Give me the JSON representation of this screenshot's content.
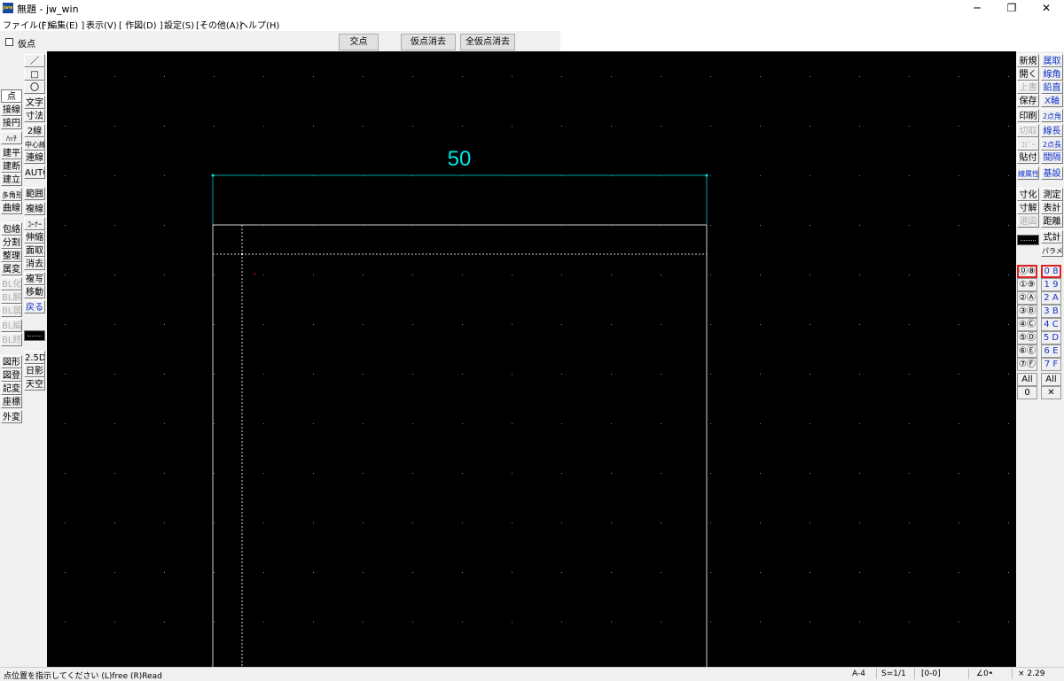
{
  "window": {
    "title": "無題 - jw_win",
    "icon_text": "Jww",
    "minimize": "─",
    "restore": "❐",
    "close": "✕"
  },
  "menu": [
    "ファイル(F)",
    "[ 編集(E) ]",
    "表示(V)",
    "[ 作図(D) ]",
    "設定(S)",
    "[その他(A)]",
    "ヘルプ(H)"
  ],
  "toolbar": {
    "kari_label": "仮点",
    "kouten": "交点",
    "karisyoukyo": "仮点消去",
    "zenkari": "全仮点消去"
  },
  "left_tools": {
    "col_a": [
      "点",
      "接線",
      "接円",
      "ﾊｯﾁ",
      "建平",
      "建断",
      "建立",
      "多角形",
      "曲線",
      "包絡",
      "分割",
      "整理",
      "属変",
      "BL化",
      "BL解",
      "BL属",
      "BL編",
      "BL終",
      "図形",
      "図登",
      "記変",
      "座標",
      "外変"
    ],
    "col_b": [
      "／",
      "□",
      "〇",
      "文字",
      "寸法",
      "2線",
      "中心線",
      "連線",
      "AUTO",
      "範囲",
      "複線",
      "ｺｰﾅｰ",
      "伸縮",
      "面取",
      "消去",
      "複写",
      "移動",
      "戻る",
      "2.5D",
      "日影",
      "天空"
    ]
  },
  "right_tools": {
    "col_a": [
      "新規",
      "開く",
      "上書",
      "保存",
      "印刷",
      "切取",
      "ｺﾋﾟｰ",
      "貼付",
      "線属性",
      "寸化",
      "寸解",
      "選図",
      "All",
      "0"
    ],
    "col_b": [
      "属取",
      "線角",
      "鉛直",
      "X軸",
      "2点角",
      "線長",
      "2点長",
      "間隔",
      "基設",
      "測定",
      "表計",
      "距離",
      "式計",
      "パラメ",
      "All",
      "✕"
    ],
    "layer_groups": [
      "⓪",
      "①",
      "②",
      "③",
      "④",
      "⑤",
      "⑥",
      "⑦"
    ],
    "layer_groups_hi": [
      "⑧",
      "⑨",
      "Ⓐ",
      "Ⓑ",
      "Ⓒ",
      "Ⓓ",
      "Ⓔ",
      "Ⓕ"
    ],
    "layers": [
      "0",
      "1",
      "2",
      "3",
      "4",
      "5",
      "6",
      "7"
    ],
    "layers_hi": [
      "8",
      "9",
      "A",
      "B",
      "C",
      "D",
      "E",
      "F"
    ]
  },
  "drawing": {
    "dimension_text": "50",
    "dimension_color": "#00e5e5",
    "line_color": "#cfcfcf",
    "aux_color": "#00a0a0"
  },
  "status": {
    "prompt": "点位置を指示してください (L)free (R)Read",
    "paper": "A-4",
    "scale": "S=1/1",
    "layer": "[0-0]",
    "angle": "∠0•",
    "zoom": "× 2.29"
  }
}
